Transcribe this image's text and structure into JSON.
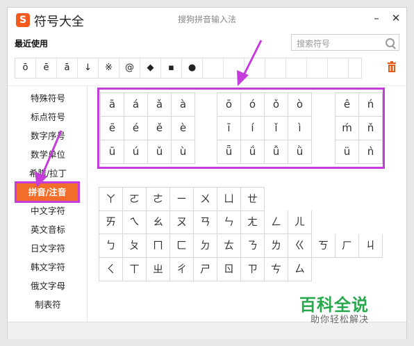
{
  "app": {
    "title": "符号大全",
    "caption": "搜狗拼音输入法",
    "logo_letter": "S",
    "minimize": "–",
    "close": "✕"
  },
  "recent": {
    "label": "最近使用",
    "symbols": [
      "ō",
      "ē",
      "ā",
      "↓",
      "※",
      "@",
      "◆",
      "▪",
      "●",
      "",
      "",
      "",
      "",
      "",
      "",
      ""
    ]
  },
  "search": {
    "placeholder": "搜索符号"
  },
  "categories": [
    {
      "label": "特殊符号"
    },
    {
      "label": "标点符号"
    },
    {
      "label": "数字序号"
    },
    {
      "label": "数学单位"
    },
    {
      "label": "希腊/拉丁"
    },
    {
      "label": "拼音/注音",
      "active": true
    },
    {
      "label": "中文字符"
    },
    {
      "label": "英文音标"
    },
    {
      "label": "日文字符"
    },
    {
      "label": "韩文字符"
    },
    {
      "label": "俄文字母"
    },
    {
      "label": "制表符"
    }
  ],
  "pinyin": {
    "group_a": [
      "ā",
      "á",
      "ǎ",
      "à",
      "ē",
      "é",
      "ě",
      "è",
      "ū",
      "ú",
      "ǔ",
      "ù"
    ],
    "group_o": [
      "ō",
      "ó",
      "ǒ",
      "ò",
      "ī",
      "í",
      "ǐ",
      "ì",
      "ǖ",
      "ǘ",
      "ǚ",
      "ǜ"
    ],
    "group_e": [
      "ê",
      "ń",
      "ḿ",
      "ň",
      "ü",
      "ǹ"
    ]
  },
  "zhuyin": {
    "row1": [
      "ㄚ",
      "ㄛ",
      "ㄜ",
      "ㄧ",
      "ㄨ",
      "ㄩ",
      "ㄝ"
    ],
    "row2": [
      "ㄞ",
      "ㄟ",
      "ㄠ",
      "ㄡ",
      "ㄢ",
      "ㄣ",
      "ㄤ",
      "ㄥ",
      "ㄦ"
    ],
    "row3": [
      "ㄅ",
      "ㄆ",
      "ㄇ",
      "ㄈ",
      "ㄉ",
      "ㄊ",
      "ㄋ",
      "ㄌ",
      "ㄍ",
      "ㄎ",
      "ㄏ",
      "ㄐ"
    ],
    "row4": [
      "ㄑ",
      "ㄒ",
      "ㄓ",
      "ㄔ",
      "ㄕ",
      "ㄖ",
      "ㄗ",
      "ㄘ",
      "ㄙ"
    ]
  },
  "watermark": {
    "title": "百科全说",
    "subtitle": "助你轻松解决"
  },
  "colors": {
    "accent": "#f46c2a",
    "highlight": "#c43cd9",
    "watermark": "#27a84d"
  }
}
